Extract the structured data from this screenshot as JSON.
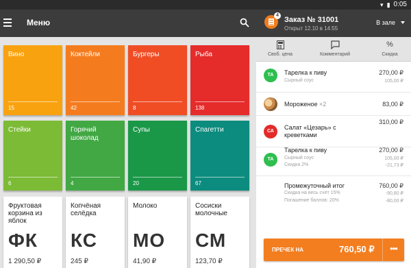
{
  "status_bar": {
    "time": "0:05",
    "wifi_icon": "wifi-icon",
    "battery_icon": "battery-icon"
  },
  "app_bar": {
    "title": "Меню"
  },
  "categories": [
    {
      "name": "Вино",
      "count": "15",
      "color": "#f9a20f"
    },
    {
      "name": "Коктейли",
      "count": "42",
      "color": "#f57c1e"
    },
    {
      "name": "Бургеры",
      "count": "8",
      "color": "#f04d25"
    },
    {
      "name": "Рыба",
      "count": "138",
      "color": "#e62b2b"
    },
    {
      "name": "Стейки",
      "count": "6",
      "color": "#7cbb35"
    },
    {
      "name": "Горячий шоколад",
      "count": "4",
      "color": "#41a843"
    },
    {
      "name": "Супы",
      "count": "20",
      "color": "#1a9848"
    },
    {
      "name": "Спагетти",
      "count": "67",
      "color": "#0c8c7e"
    }
  ],
  "products": [
    {
      "name": "Фруктовая корзина из яблок",
      "abbr": "ФК",
      "price": "1 290,50 ₽"
    },
    {
      "name": "Копчёная селёдка",
      "abbr": "КС",
      "price": "245 ₽"
    },
    {
      "name": "Молоко",
      "abbr": "МО",
      "price": "41,90 ₽"
    },
    {
      "name": "Сосиски молочные",
      "abbr": "СМ",
      "price": "123,70 ₽"
    }
  ],
  "order": {
    "title": "Заказ № 31001",
    "subtitle": "Открыт 12.10 в 14:55",
    "mode": "В зале",
    "badge": "4",
    "accent": "#f37e1f"
  },
  "actions": [
    {
      "label": "Своб. цена",
      "icon": "calculator-icon"
    },
    {
      "label": "Комментарий",
      "icon": "comment-icon"
    },
    {
      "label": "Скидка",
      "icon": "percent-icon"
    }
  ],
  "items": [
    {
      "avatar": "ТА",
      "avatar_color": "#2ebf4f",
      "name": "Тарелка к пиву",
      "price": "270,00 ₽",
      "subs": [
        {
          "label": "Сырный соус",
          "value": "105,00 ₽"
        }
      ]
    },
    {
      "avatar": "",
      "avatar_color": "",
      "name": "Мороженое",
      "qty": "×2",
      "price": "83,00 ₽",
      "subs": []
    },
    {
      "avatar": "СА",
      "avatar_color": "#e32a2a",
      "name": "Салат «Цезарь» с креветками",
      "price": "310,00 ₽",
      "subs": []
    },
    {
      "avatar": "ТА",
      "avatar_color": "#2ebf4f",
      "name": "Тарелка к пиву",
      "price": "270,00 ₽",
      "subs": [
        {
          "label": "Сырный соус",
          "value": "105,00 ₽"
        },
        {
          "label": "Скидка 2%",
          "value": "-21,73 ₽"
        }
      ]
    }
  ],
  "summary": {
    "label": "Промежуточный итог",
    "value": "760,00 ₽",
    "discount_label": "Скидка на весь счёт 15%",
    "discount_value": "-90,80 ₽",
    "points_label": "Погашение баллов: 20%",
    "points_value": "-80,00 ₽"
  },
  "checkout": {
    "label": "ПРЕЧЕК НА",
    "amount": "760,50 ₽",
    "more": "•••"
  }
}
